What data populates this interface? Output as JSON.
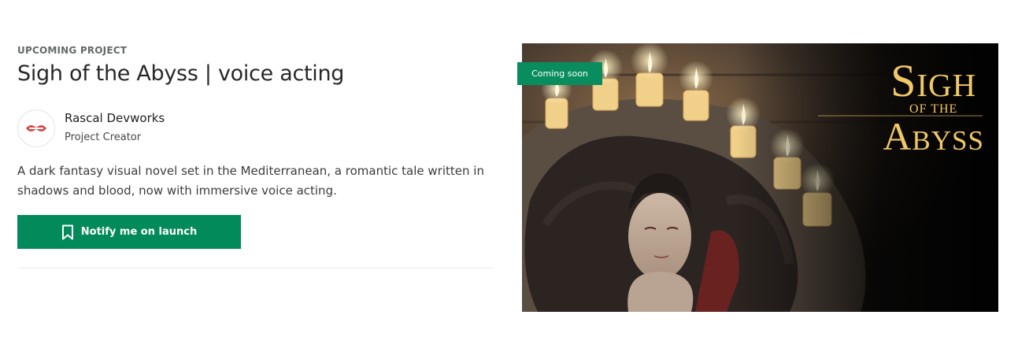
{
  "project": {
    "eyebrow": "UPCOMING PROJECT",
    "title": "Sigh of the Abyss | voice acting",
    "description": "A dark fantasy visual novel set in the Mediterranean, a romantic tale written in shadows and blood, now with immersive voice acting."
  },
  "creator": {
    "name": "Rascal Devworks",
    "role": "Project Creator",
    "avatar_icon": "rascal-devworks-logo"
  },
  "actions": {
    "notify_label": "Notify me on launch",
    "notify_icon": "bookmark-icon"
  },
  "hero": {
    "badge": "Coming soon",
    "art_title_main": "Sigh",
    "art_title_of": "OF THE",
    "art_title_sub": "Abyss"
  },
  "colors": {
    "primary_green": "#038a5a",
    "badge_green": "#0a8d5e",
    "art_gold": "#f0c866"
  }
}
